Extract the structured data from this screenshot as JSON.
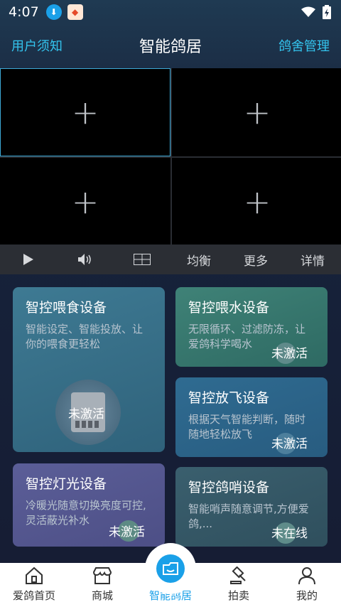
{
  "status_bar": {
    "time": "4:07"
  },
  "header": {
    "left_link": "用户须知",
    "title": "智能鸽居",
    "right_link": "鸽舍管理"
  },
  "video_grid": {
    "cells": [
      "+",
      "+",
      "+",
      "+"
    ]
  },
  "controls": {
    "balance": "均衡",
    "more": "更多",
    "details": "详情"
  },
  "cards": {
    "feed": {
      "title": "智控喂食设备",
      "desc": "智能设定、智能投放、让你的喂食更轻松",
      "status": "未激活"
    },
    "water": {
      "title": "智控喂水设备",
      "desc": "无限循环、过滤防冻，让爱鸽科学喝水",
      "status": "未激活"
    },
    "fly": {
      "title": "智控放飞设备",
      "desc": "根据天气智能判断，随时随地轻松放飞",
      "status": "未激活"
    },
    "light": {
      "title": "智控灯光设备",
      "desc": "冷暖光随意切换亮度可控,灵活蔽光补水",
      "status": "未激活"
    },
    "whistle": {
      "title": "智控鸽哨设备",
      "desc": "智能哨声随意调节,方便爱鸽,...",
      "status": "未在线"
    }
  },
  "bottom_nav": {
    "home": "爱鸽首页",
    "shop": "商城",
    "smart_home": "智能鸽居",
    "auction": "拍卖",
    "mine": "我的"
  },
  "colors": {
    "accent": "#1aa0e8",
    "link": "#33c4ee"
  }
}
